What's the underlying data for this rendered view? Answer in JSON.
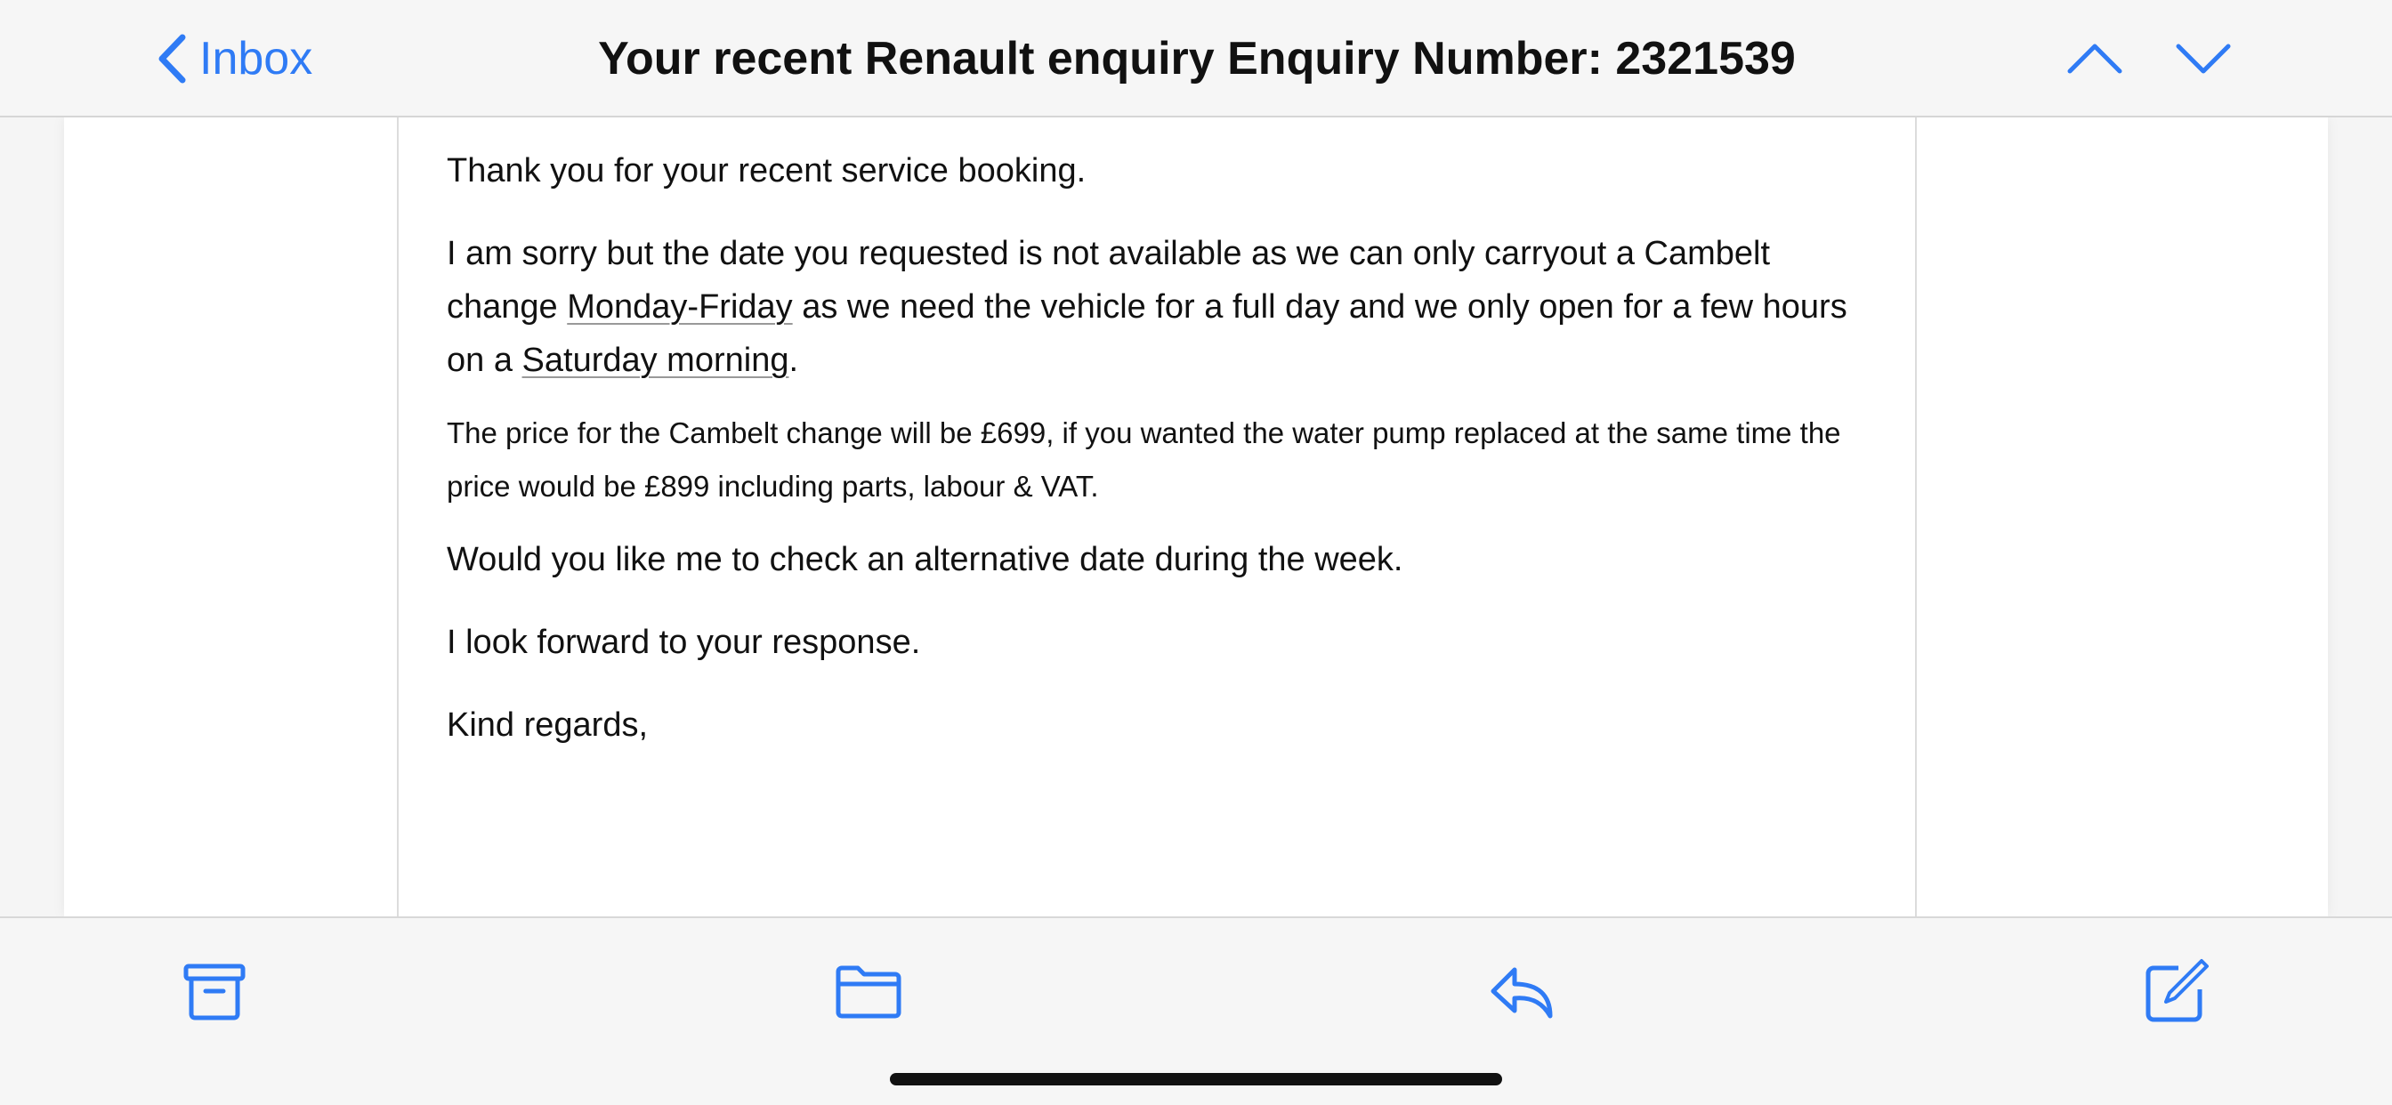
{
  "nav": {
    "back_label": "Inbox",
    "title": "Your recent Renault enquiry Enquiry Number: 2321539",
    "prev_icon": "chevron-up-icon",
    "next_icon": "chevron-down-icon"
  },
  "email": {
    "p1": "Thank you for your recent service booking.",
    "p2_part1": "I am sorry but the date you requested is not available as we can only carryout a Cambelt change ",
    "p2_link1": "Monday-Friday",
    "p2_part2": " as we need the vehicle for a full day and we only open for a few hours on a ",
    "p2_link2": "Saturday morning",
    "p2_part3": ".",
    "p3": "The price for the Cambelt change will be £699, if you wanted the water pump replaced at the same time the price would be £899 including parts, labour & VAT.",
    "p4": "Would you like me to check an alternative date during the week.",
    "p5": "I look forward to your response.",
    "p6": "Kind regards,"
  },
  "toolbar": {
    "icons": [
      "archive-icon",
      "folder-icon",
      "reply-icon",
      "compose-icon"
    ]
  },
  "colors": {
    "accent": "#2f7bf5",
    "bar_background": "#f6f6f6",
    "text": "#111111"
  }
}
